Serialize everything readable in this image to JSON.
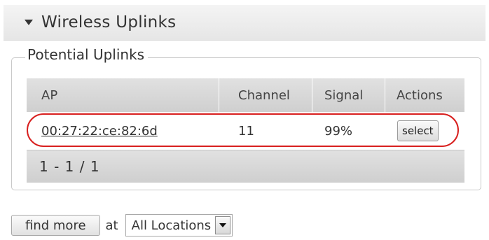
{
  "section": {
    "title": "Wireless Uplinks",
    "collapse_icon": "triangle-down-icon"
  },
  "group": {
    "legend": "Potential Uplinks"
  },
  "table": {
    "columns": [
      "AP",
      "Channel",
      "Signal",
      "Actions"
    ],
    "rows": [
      {
        "ap": "00:27:22:ce:82:6d",
        "channel": "11",
        "signal": "99%",
        "action_label": "select"
      }
    ],
    "pager": "1 - 1 / 1",
    "highlight_color": "#d8201f"
  },
  "controls": {
    "find_more_label": "find more",
    "at_label": "at",
    "location_value": "All Locations",
    "location_icon": "chevron-down-icon"
  }
}
